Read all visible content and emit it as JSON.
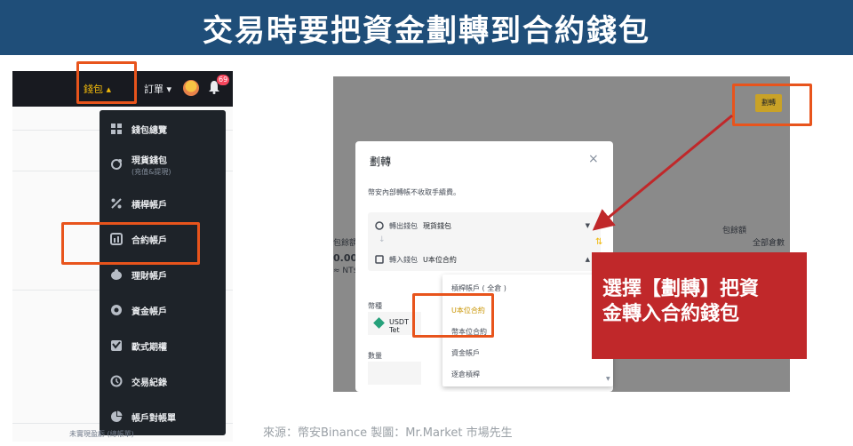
{
  "banner": {
    "title": "交易時要把資金劃轉到合約錢包"
  },
  "left_panel": {
    "nav": {
      "wallet": "錢包 ▴",
      "orders": "訂單 ▾",
      "badge": "69"
    },
    "menu": [
      {
        "label": "錢包總覽",
        "sub": "",
        "icon": "grid-icon"
      },
      {
        "label": "現貨錢包",
        "sub": "(充值&提現)",
        "icon": "spot-wallet-icon"
      },
      {
        "label": "槓桿帳戶",
        "sub": "",
        "icon": "percent-icon"
      },
      {
        "label": "合約帳戶",
        "sub": "",
        "icon": "futures-icon"
      },
      {
        "label": "理財帳戶",
        "sub": "",
        "icon": "piggy-bank-icon"
      },
      {
        "label": "資金帳戶",
        "sub": "",
        "icon": "funding-icon"
      },
      {
        "label": "歐式期權",
        "sub": "",
        "icon": "options-icon"
      },
      {
        "label": "交易紀錄",
        "sub": "",
        "icon": "history-icon"
      },
      {
        "label": "帳戶對帳單",
        "sub": "",
        "icon": "pie-chart-icon"
      }
    ],
    "footer": "未實現盈虧 (總帳單)"
  },
  "right_panel": {
    "transfer_button": "劃轉",
    "bg_left_1": "包餘額",
    "bg_left_2": "0.000",
    "bg_left_3": "≈ NT$",
    "bg_right_1": "包餘額",
    "bg_right_2": "全部倉數",
    "modal": {
      "title": "劃轉",
      "close": "×",
      "note": "幣安內部轉帳不收取手續費。",
      "from_label": "轉出錢包",
      "from_value": "現貨錢包",
      "to_label": "轉入錢包",
      "to_value": "U本位合約",
      "arrow": "↓",
      "swap": "⇅",
      "coin_label": "幣種",
      "coin_value": "USDT Tet",
      "qty_label": "數量"
    },
    "dropdown": [
      {
        "label": "槓桿帳戶 ( 全倉 )",
        "selected": false
      },
      {
        "label": "U本位合約",
        "selected": true
      },
      {
        "label": "幣本位合約",
        "selected": false
      },
      {
        "label": "資金帳戶",
        "selected": false
      },
      {
        "label": "逐倉槓桿",
        "selected": false
      }
    ]
  },
  "callout": {
    "line1": "選擇【劃轉】把資",
    "line2": "金轉入合約錢包"
  },
  "source": "來源：幣安Binance  製圖：Mr.Market 市場先生",
  "colors": {
    "banner": "#1f4e79",
    "highlight": "#e8541c",
    "callout": "#c0282a",
    "binance_yellow": "#f0b90b",
    "dark_menu": "#1e2329"
  }
}
